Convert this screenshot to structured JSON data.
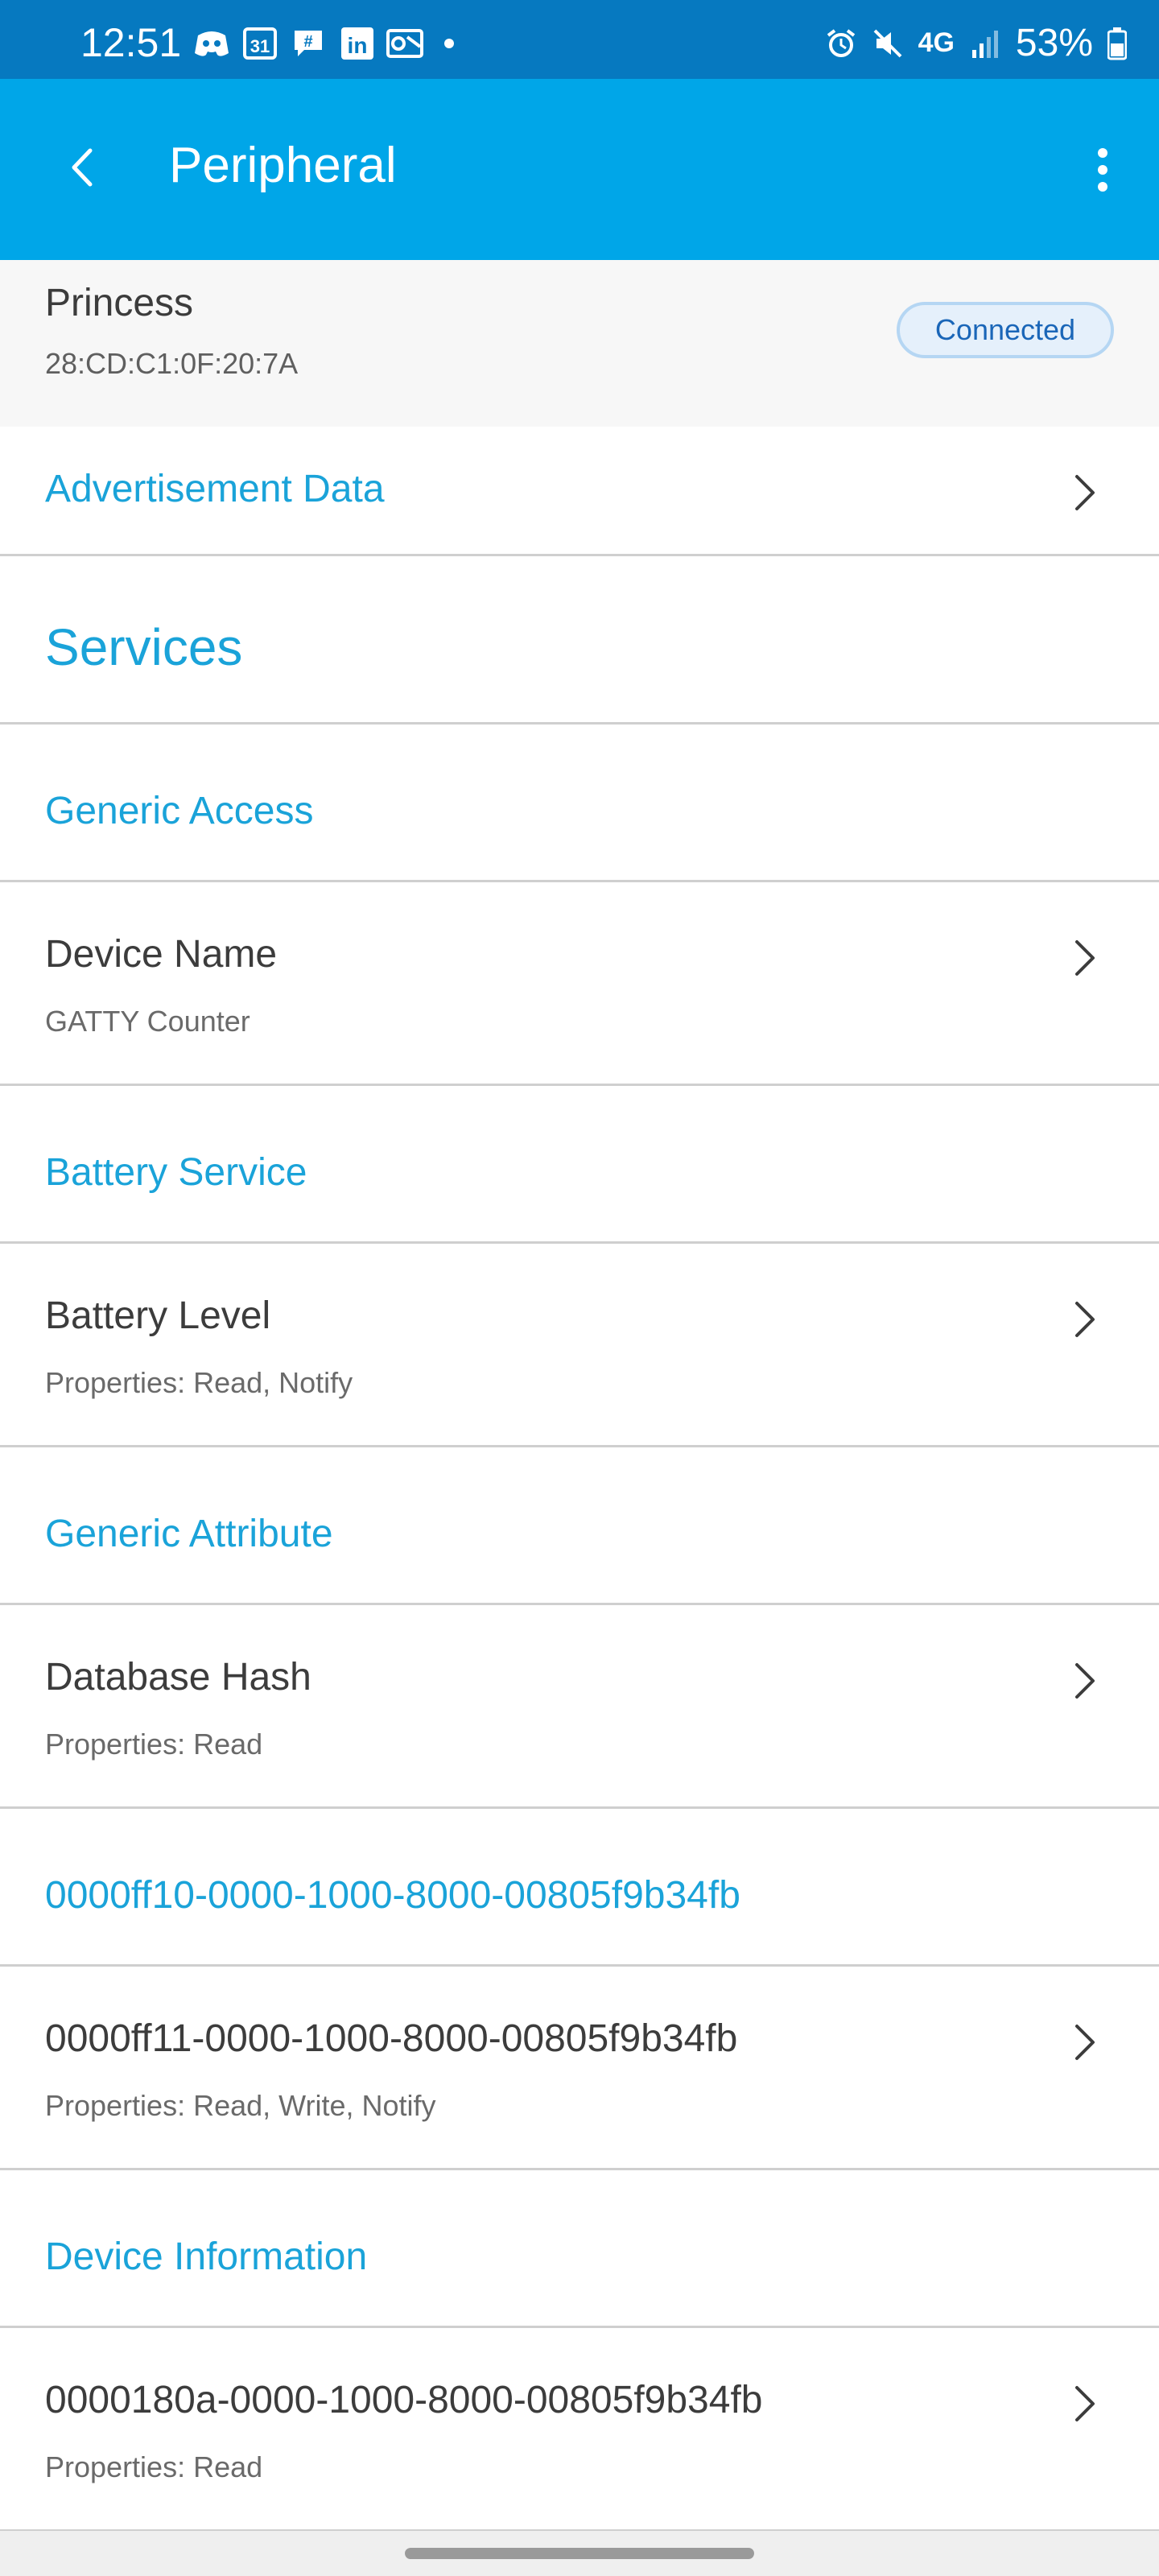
{
  "status_bar": {
    "time": "12:51",
    "calendar_day": "31",
    "network": "4G",
    "battery": "53%"
  },
  "app_bar": {
    "title": "Peripheral"
  },
  "device": {
    "name": "Princess",
    "mac": "28:CD:C1:0F:20:7A",
    "status": "Connected"
  },
  "advertisement": {
    "label": "Advertisement Data"
  },
  "services_heading": "Services",
  "services": [
    {
      "name": "Generic Access",
      "characteristics": [
        {
          "name": "Device Name",
          "subtitle": "GATTY Counter"
        }
      ]
    },
    {
      "name": "Battery Service",
      "characteristics": [
        {
          "name": "Battery Level",
          "subtitle": "Properties: Read, Notify"
        }
      ]
    },
    {
      "name": "Generic Attribute",
      "characteristics": [
        {
          "name": "Database Hash",
          "subtitle": "Properties: Read"
        }
      ]
    },
    {
      "name": "0000ff10-0000-1000-8000-00805f9b34fb",
      "characteristics": [
        {
          "name": "0000ff11-0000-1000-8000-00805f9b34fb",
          "subtitle": "Properties: Read, Write, Notify"
        }
      ]
    },
    {
      "name": "Device Information",
      "characteristics": [
        {
          "name": "0000180a-0000-1000-8000-00805f9b34fb",
          "subtitle": "Properties: Read"
        }
      ]
    }
  ],
  "colors": {
    "status_bar": "#0679c0",
    "app_bar": "#00a6e8",
    "accent_text": "#1aa3d9",
    "badge_border": "#b5d6f3",
    "badge_text": "#1a66b8"
  }
}
